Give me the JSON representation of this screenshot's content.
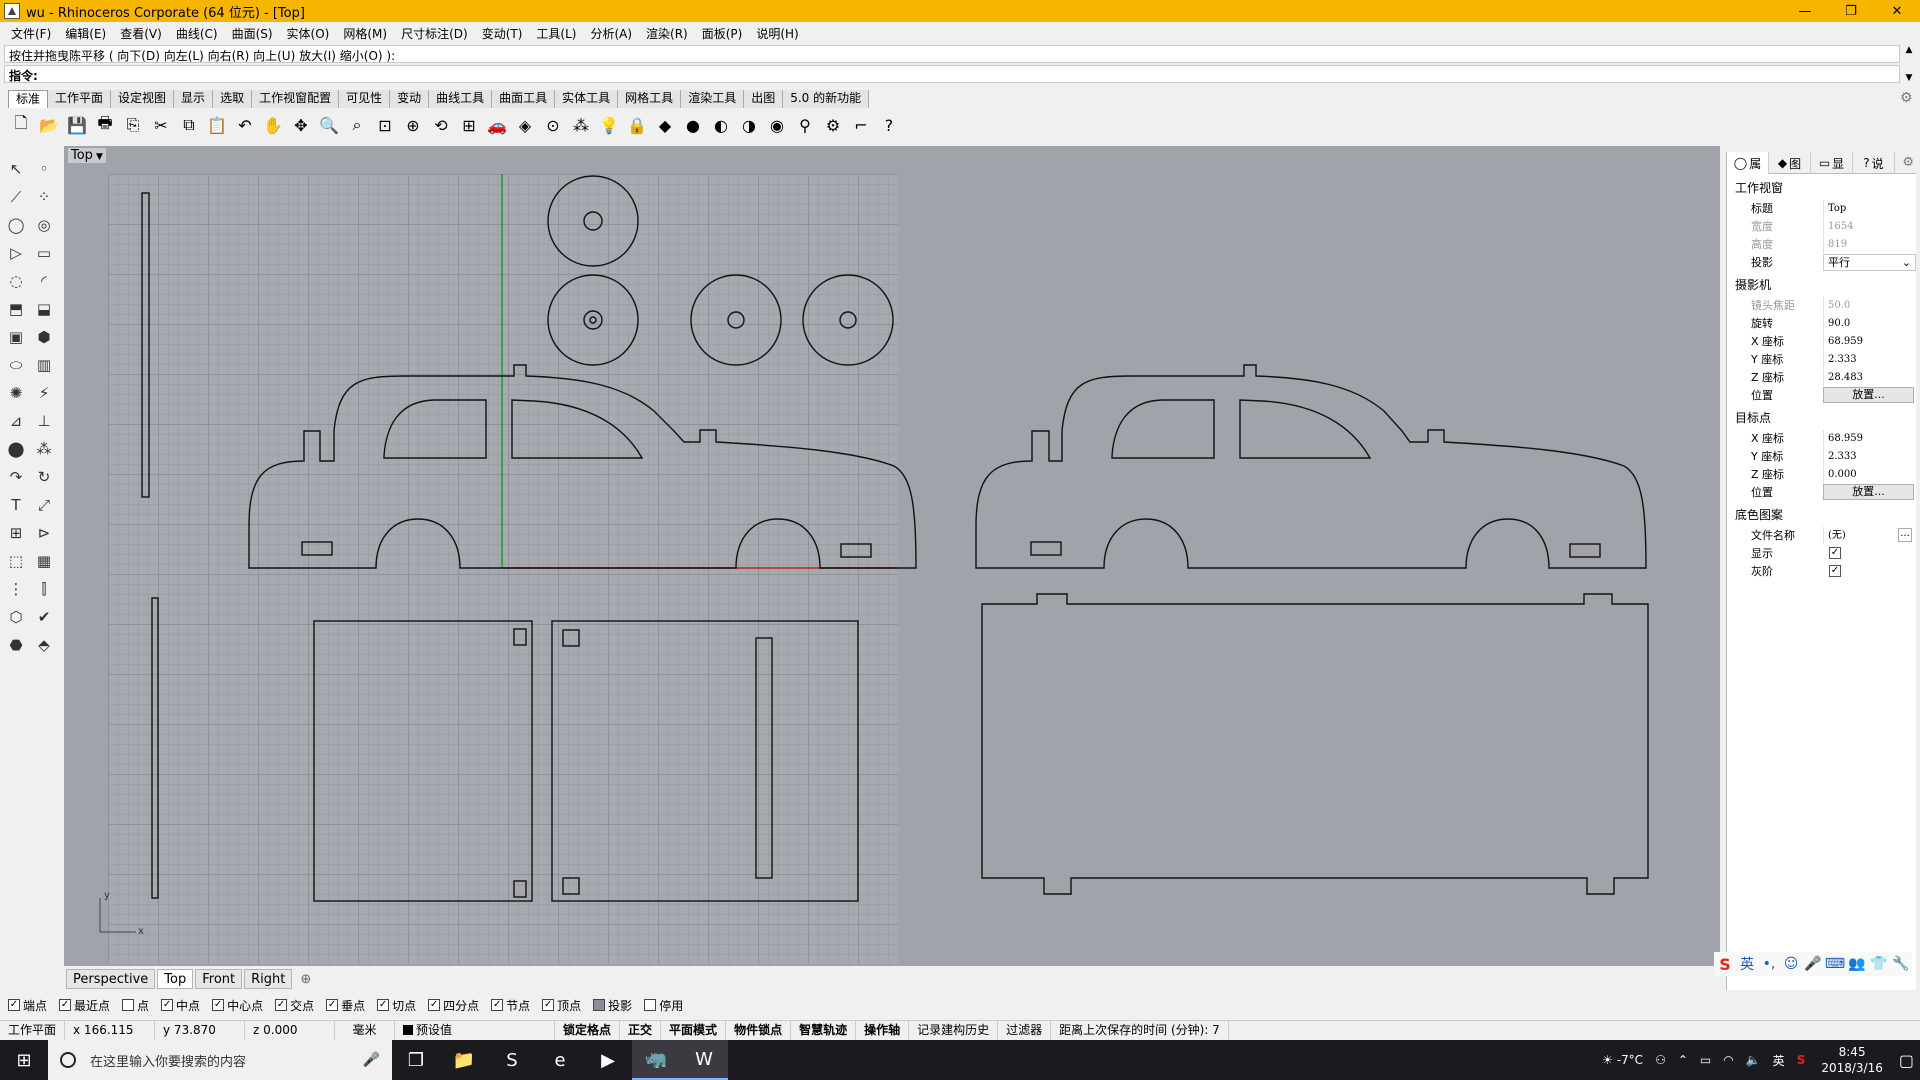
{
  "window": {
    "title": "wu - Rhinoceros Corporate (64 位元) - [Top]",
    "controls": [
      "—",
      "❐",
      "✕"
    ]
  },
  "menu": [
    "文件(F)",
    "编辑(E)",
    "查看(V)",
    "曲线(C)",
    "曲面(S)",
    "实体(O)",
    "网格(M)",
    "尺寸标注(D)",
    "变动(T)",
    "工具(L)",
    "分析(A)",
    "渲染(R)",
    "面板(P)",
    "说明(H)"
  ],
  "command": {
    "history": "按住并拖曳陈平移 ( 向下(D)  向左(L)  向右(R)  向上(U)  放大(I)  缩小(O) ):",
    "prompt": "指令:"
  },
  "toolbar_tabs": [
    "标准",
    "工作平面",
    "设定视图",
    "显示",
    "选取",
    "工作视窗配置",
    "可见性",
    "变动",
    "曲线工具",
    "曲面工具",
    "实体工具",
    "网格工具",
    "渲染工具",
    "出图",
    "5.0 的新功能"
  ],
  "toolbar_icons": [
    {
      "name": "new-icon",
      "glyph": "🗋"
    },
    {
      "name": "open-icon",
      "glyph": "📂"
    },
    {
      "name": "save-icon",
      "glyph": "💾"
    },
    {
      "name": "print-icon",
      "glyph": "🖶"
    },
    {
      "name": "import-icon",
      "glyph": "⎘"
    },
    {
      "name": "cut-icon",
      "glyph": "✂"
    },
    {
      "name": "copy-icon",
      "glyph": "⧉"
    },
    {
      "name": "paste-icon",
      "glyph": "📋"
    },
    {
      "name": "undo-icon",
      "glyph": "↶"
    },
    {
      "name": "pan-icon",
      "glyph": "✋"
    },
    {
      "name": "move-view-icon",
      "glyph": "✥"
    },
    {
      "name": "zoom-icon",
      "glyph": "🔍"
    },
    {
      "name": "zoom-window-icon",
      "glyph": "⌕"
    },
    {
      "name": "zoom-extents-icon",
      "glyph": "⊡"
    },
    {
      "name": "zoom-selected-icon",
      "glyph": "⊕"
    },
    {
      "name": "rotate-view-icon",
      "glyph": "⟲"
    },
    {
      "name": "viewport-layout-icon",
      "glyph": "⊞"
    },
    {
      "name": "car-icon",
      "glyph": "🚗"
    },
    {
      "name": "cplane-icon",
      "glyph": "◈"
    },
    {
      "name": "osnap-icon",
      "glyph": "⊙"
    },
    {
      "name": "points-icon",
      "glyph": "⁂"
    },
    {
      "name": "light-icon",
      "glyph": "💡"
    },
    {
      "name": "lock-icon",
      "glyph": "🔒"
    },
    {
      "name": "layer-icon",
      "glyph": "◆"
    },
    {
      "name": "color-icon",
      "glyph": "●"
    },
    {
      "name": "shade-icon",
      "glyph": "◐"
    },
    {
      "name": "render-icon",
      "glyph": "◑"
    },
    {
      "name": "render-preview-icon",
      "glyph": "◉"
    },
    {
      "name": "filter-icon",
      "glyph": "⚲"
    },
    {
      "name": "settings-icon",
      "glyph": "⚙"
    },
    {
      "name": "dimension-icon",
      "glyph": "⌐"
    },
    {
      "name": "help-icon",
      "glyph": "?"
    }
  ],
  "palette_icons": [
    [
      "select-arrow-icon",
      "point-icon"
    ],
    [
      "polyline-icon",
      "curve-points-icon"
    ],
    [
      "circle-icon",
      "ellipse-icon"
    ],
    [
      "polygon-icon",
      "rectangle-icon"
    ],
    [
      "arc-circle-icon",
      "arc-icon"
    ],
    [
      "surface-corner-icon",
      "surface-patch-icon"
    ],
    [
      "box-icon",
      "sphere-group-icon"
    ],
    [
      "cylinder-icon",
      "extrude-icon"
    ],
    [
      "fillet-icon",
      "explode-icon"
    ],
    [
      "trim-icon",
      "split-icon"
    ],
    [
      "boolean-union-icon",
      "boolean-icon"
    ],
    [
      "fillet-curve-icon",
      "offset-icon"
    ],
    [
      "text-icon",
      "transform-icon"
    ],
    [
      "group-icon",
      "align-icon"
    ],
    [
      "solid-tools-icon",
      "array-icon"
    ],
    [
      "grid-array-icon",
      "analysis-icon"
    ],
    [
      "mesh-icon",
      "check-icon"
    ],
    [
      "render-mesh-icon",
      "dimension-tools-icon"
    ]
  ],
  "viewport": {
    "name": "Top",
    "axis_x": "x",
    "axis_y": "y"
  },
  "viewport_tabs": [
    "Perspective",
    "Top",
    "Front",
    "Right"
  ],
  "panel": {
    "tabs": [
      "属",
      "图",
      "显",
      "说"
    ],
    "sections": [
      {
        "title": "工作视窗",
        "rows": [
          {
            "key": "标题",
            "value": "Top",
            "type": "text"
          },
          {
            "key": "宽度",
            "value": "1654",
            "type": "disabled"
          },
          {
            "key": "高度",
            "value": "819",
            "type": "disabled"
          },
          {
            "key": "投影",
            "value": "平行",
            "type": "select"
          }
        ]
      },
      {
        "title": "摄影机",
        "rows": [
          {
            "key": "镜头焦距",
            "value": "50.0",
            "type": "disabled"
          },
          {
            "key": "旋转",
            "value": "90.0",
            "type": "text"
          },
          {
            "key": "X 座标",
            "value": "68.959",
            "type": "text"
          },
          {
            "key": "Y 座标",
            "value": "2.333",
            "type": "text"
          },
          {
            "key": "Z 座标",
            "value": "28.483",
            "type": "text"
          },
          {
            "key": "位置",
            "value": "放置...",
            "type": "button"
          }
        ]
      },
      {
        "title": "目标点",
        "rows": [
          {
            "key": "X 座标",
            "value": "68.959",
            "type": "text"
          },
          {
            "key": "Y 座标",
            "value": "2.333",
            "type": "text"
          },
          {
            "key": "Z 座标",
            "value": "0.000",
            "type": "text"
          },
          {
            "key": "位置",
            "value": "放置...",
            "type": "button"
          }
        ]
      },
      {
        "title": "底色图案",
        "rows": [
          {
            "key": "文件名称",
            "value": "(无)",
            "type": "file"
          },
          {
            "key": "显示",
            "value": "✓",
            "type": "check"
          },
          {
            "key": "灰阶",
            "value": "✓",
            "type": "check"
          }
        ]
      }
    ]
  },
  "ime": [
    "S",
    "英",
    "•,",
    "☺",
    "🎤",
    "⌨",
    "👥",
    "👕",
    "🔧"
  ],
  "snaps": [
    {
      "label": "端点",
      "checked": true
    },
    {
      "label": "最近点",
      "checked": true
    },
    {
      "label": "点",
      "checked": false
    },
    {
      "label": "中点",
      "checked": true
    },
    {
      "label": "中心点",
      "checked": true
    },
    {
      "label": "交点",
      "checked": true
    },
    {
      "label": "垂点",
      "checked": true
    },
    {
      "label": "切点",
      "checked": true
    },
    {
      "label": "四分点",
      "checked": true
    },
    {
      "label": "节点",
      "checked": true
    },
    {
      "label": "顶点",
      "checked": true
    },
    {
      "label": "投影",
      "checked": false
    },
    {
      "label": "停用",
      "checked": false
    }
  ],
  "status": {
    "plane": "工作平面",
    "x": "x 166.115",
    "y": "y 73.870",
    "z": "z 0.000",
    "unit": "毫米",
    "layer": "预设值",
    "modes": [
      "锁定格点",
      "正交",
      "平面模式",
      "物件锁点",
      "智慧轨迹",
      "操作轴"
    ],
    "extras": [
      "记录建构历史",
      "过滤器",
      "距离上次保存的时间 (分钟): 7"
    ]
  },
  "taskbar": {
    "search_placeholder": "在这里输入你要搜索的内容",
    "apps": [
      "task-view-icon",
      "explorer-icon",
      "sogou-icon",
      "ie-icon",
      "media-icon",
      "rhino-icon",
      "word-icon"
    ],
    "app_glyphs": [
      "❐",
      "📁",
      "S",
      "e",
      "▶",
      "🦏",
      "W"
    ],
    "weather": "☀ -7°C",
    "time": "8:45",
    "date": "2018/3/16",
    "tray_lang": "英"
  }
}
